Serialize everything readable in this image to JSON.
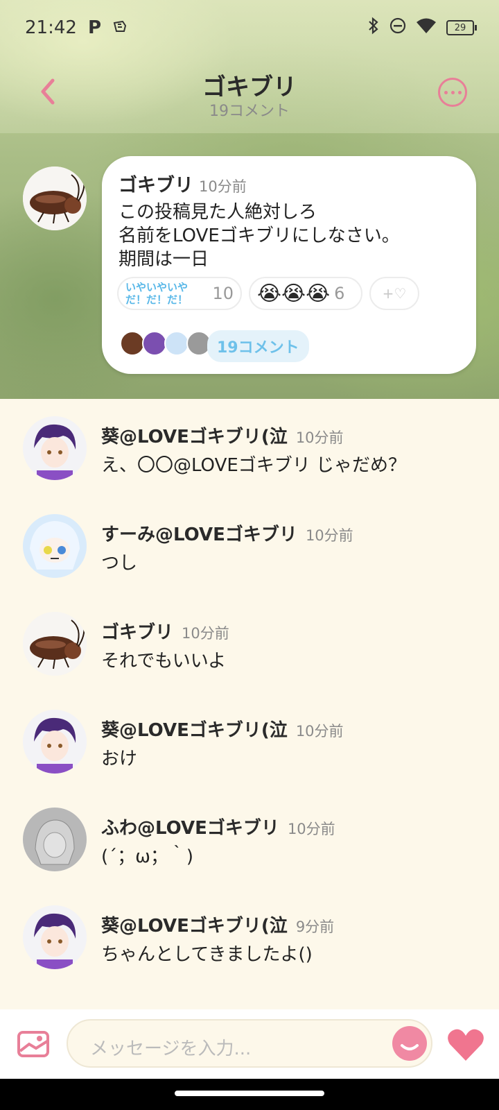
{
  "status_bar": {
    "time": "21:42",
    "p_icon": "P",
    "battery": "29"
  },
  "header": {
    "title": "ゴキブリ",
    "subtitle": "19コメント"
  },
  "post": {
    "author": "ゴキブリ",
    "time": "10分前",
    "lines": [
      "この投稿見た人絶対しろ",
      "名前をLOVEゴキブリにしなさい。",
      "期間は一日"
    ],
    "reactions": [
      {
        "label": "いやいやいや\nだ！だ！だ！",
        "count": "10"
      },
      {
        "emoji": "😭😭😭",
        "count": "6"
      },
      {
        "label": "+♡"
      }
    ],
    "comment_count_label": "19コメント"
  },
  "comments": [
    {
      "name": "葵@LOVEゴキブリ(泣",
      "time": "10分前",
      "text": "え、〇〇@LOVEゴキブリ じゃだめ？"
    },
    {
      "name": "すーみ@LOVEゴキブリ",
      "time": "10分前",
      "text": "つし"
    },
    {
      "name": "ゴキブリ",
      "time": "10分前",
      "text": "それでもいいよ"
    },
    {
      "name": "葵@LOVEゴキブリ(泣",
      "time": "10分前",
      "text": "おけ"
    },
    {
      "name": "ふわ@LOVEゴキブリ",
      "time": "10分前",
      "text": "(´；ω；｀)"
    },
    {
      "name": "葵@LOVEゴキブリ(泣",
      "time": "9分前",
      "text": "ちゃんとしてきましたよ()"
    }
  ],
  "composer": {
    "placeholder": "メッセージを入力..."
  },
  "colors": {
    "accent": "#e87f98",
    "comment_bg": "#fdf8ea",
    "chip_bg": "#e4f2fa",
    "chip_text": "#6ec1ea"
  }
}
